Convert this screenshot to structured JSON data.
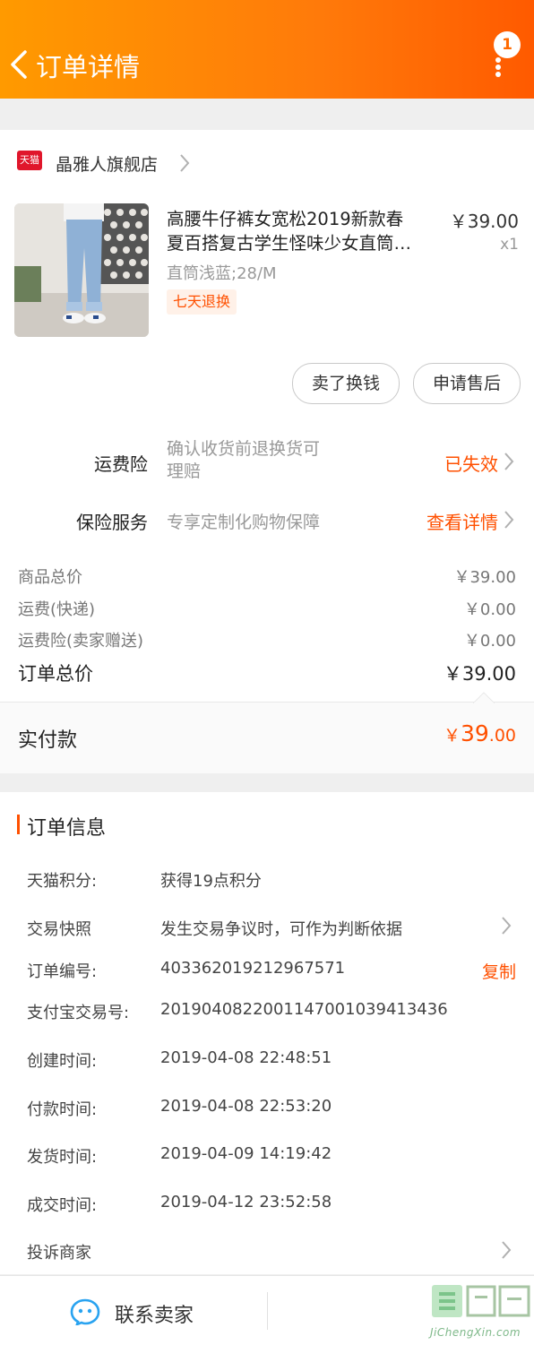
{
  "header": {
    "title": "订单详情",
    "badge_count": "1"
  },
  "store": {
    "platform_badge": "天猫",
    "name": "晶雅人旗舰店"
  },
  "product": {
    "title_line1": "高腰牛仔裤女宽松2019新款春",
    "title_line2": "夏百搭复古学生怪味少女直筒…",
    "sku": "直筒浅蓝;28/M",
    "tag": "七天退换",
    "price": "￥39.00",
    "quantity": "x1"
  },
  "actions": {
    "sell_label": "卖了换钱",
    "after_sale_label": "申请售后"
  },
  "services": [
    {
      "name": "运费险",
      "desc_line1": "确认收货前退换货可",
      "desc_line2": "理赔",
      "status": "已失效"
    },
    {
      "name": "保险服务",
      "desc_line1": "专享定制化购物保障",
      "status": "查看详情"
    }
  ],
  "price_summary": {
    "goods_total_label": "商品总价",
    "goods_total_value": "￥39.00",
    "shipping_label": "运费(快递)",
    "shipping_value": "￥0.00",
    "insurance_label": "运费险(卖家赠送)",
    "insurance_value": "￥0.00",
    "order_total_label": "订单总价",
    "order_total_value": "￥39.00",
    "paid_label": "实付款",
    "paid_currency": "￥",
    "paid_integer": "39",
    "paid_decimal": ".00"
  },
  "order_info": {
    "section_title": "订单信息",
    "points_label": "天猫积分:",
    "points_value": "获得19点积分",
    "snapshot_label": "交易快照",
    "snapshot_value": "发生交易争议时，可作为判断依据",
    "order_no_label": "订单编号:",
    "order_no_value": "403362019212967571",
    "copy_label": "复制",
    "alipay_label": "支付宝交易号:",
    "alipay_value": "2019040822001147001039413436",
    "created_label": "创建时间:",
    "created_value": "2019-04-08 22:48:51",
    "paid_time_label": "付款时间:",
    "paid_time_value": "2019-04-08 22:53:20",
    "shipped_label": "发货时间:",
    "shipped_value": "2019-04-09 14:19:42",
    "completed_label": "成交时间:",
    "completed_value": "2019-04-12 23:52:58",
    "complaint_label": "投诉商家"
  },
  "bottom_bar": {
    "contact_label": "联系卖家"
  },
  "watermark": {
    "text": "JiChengXin.com"
  },
  "colors": {
    "accent": "#ff5000",
    "header_start": "#ff9a00",
    "header_end": "#ff5a00"
  }
}
